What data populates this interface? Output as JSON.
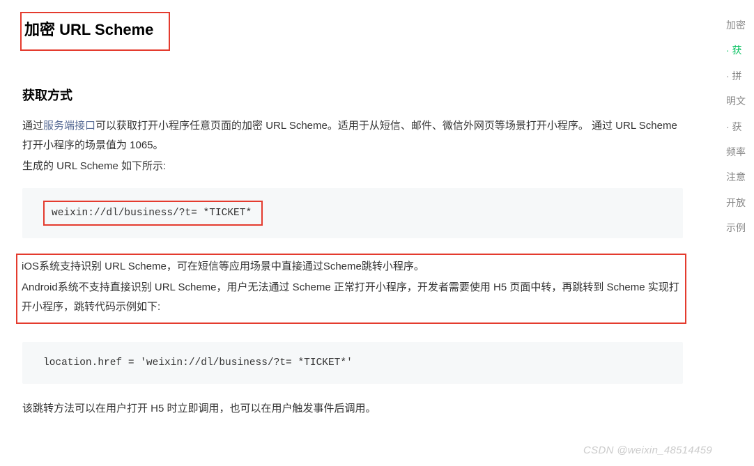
{
  "title": "加密 URL Scheme",
  "section1": {
    "heading": "获取方式",
    "p1_prefix": "通过",
    "p1_link": "服务端接口",
    "p1_suffix": "可以获取打开小程序任意页面的加密 URL Scheme。适用于从短信、邮件、微信外网页等场景打开小程序。 通过 URL Scheme 打开小程序的场景值为 1065。",
    "p2": "生成的 URL Scheme 如下所示:",
    "code1": "weixin://dl/business/?t= *TICKET*",
    "p3": "iOS系统支持识别 URL Scheme，可在短信等应用场景中直接通过Scheme跳转小程序。",
    "p4": "Android系统不支持直接识别 URL Scheme，用户无法通过 Scheme 正常打开小程序，开发者需要使用 H5 页面中转，再跳转到 Scheme 实现打开小程序，跳转代码示例如下:",
    "code2": "location.href = 'weixin://dl/business/?t= *TICKET*'",
    "p5": "该跳转方法可以在用户打开 H5 时立即调用，也可以在用户触发事件后调用。"
  },
  "rightNav": {
    "items": [
      "加密",
      "· 获",
      "· 拼",
      "明文",
      "· 获",
      "频率",
      "注意",
      "开放",
      "示例"
    ],
    "activeIndex": 1
  },
  "watermark": "CSDN @weixin_48514459"
}
